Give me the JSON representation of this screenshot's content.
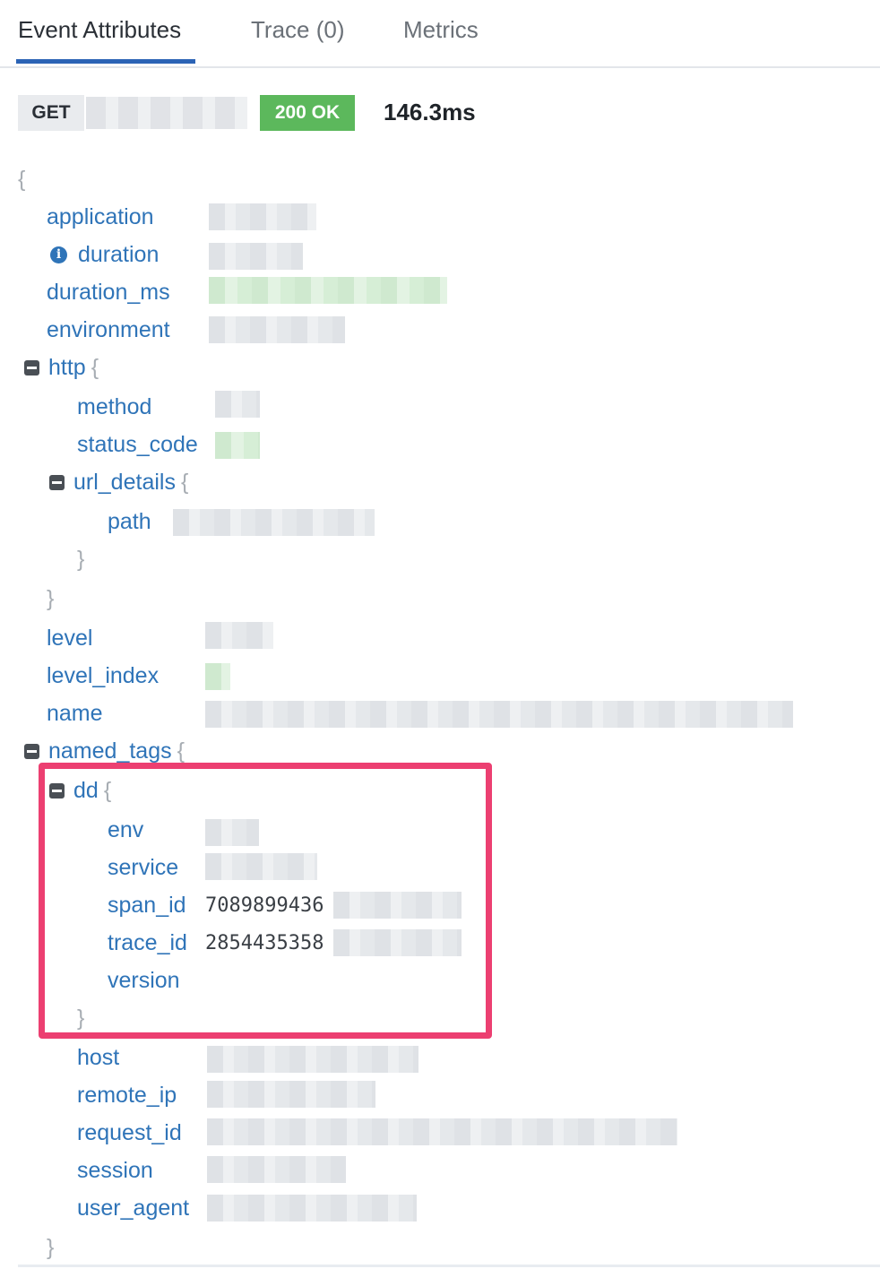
{
  "tabs": [
    {
      "label": "Event Attributes",
      "active": true
    },
    {
      "label": "Trace (0)",
      "active": false
    },
    {
      "label": "Metrics",
      "active": false
    }
  ],
  "request": {
    "method": "GET",
    "status": "200 OK",
    "duration": "146.3ms"
  },
  "colors": {
    "accent": "#2b63b5",
    "status_ok": "#5cb85c",
    "key": "#2f74b8",
    "highlight": "#ec3f71"
  },
  "tree": {
    "root_open": "{",
    "root_close": "}",
    "keys": {
      "application": "application",
      "duration": "duration",
      "duration_ms": "duration_ms",
      "environment": "environment",
      "http": "http",
      "method": "method",
      "status_code": "status_code",
      "url_details": "url_details",
      "path": "path",
      "level": "level",
      "level_index": "level_index",
      "name": "name",
      "named_tags": "named_tags",
      "dd": "dd",
      "env": "env",
      "service": "service",
      "span_id": "span_id",
      "trace_id": "trace_id",
      "version": "version",
      "host": "host",
      "remote_ip": "remote_ip",
      "request_id": "request_id",
      "session": "session",
      "user_agent": "user_agent"
    },
    "values": {
      "span_id": "7089899436",
      "trace_id": "2854435358"
    },
    "icons": {
      "duration_info": "info-icon",
      "info_glyph": "i"
    }
  }
}
